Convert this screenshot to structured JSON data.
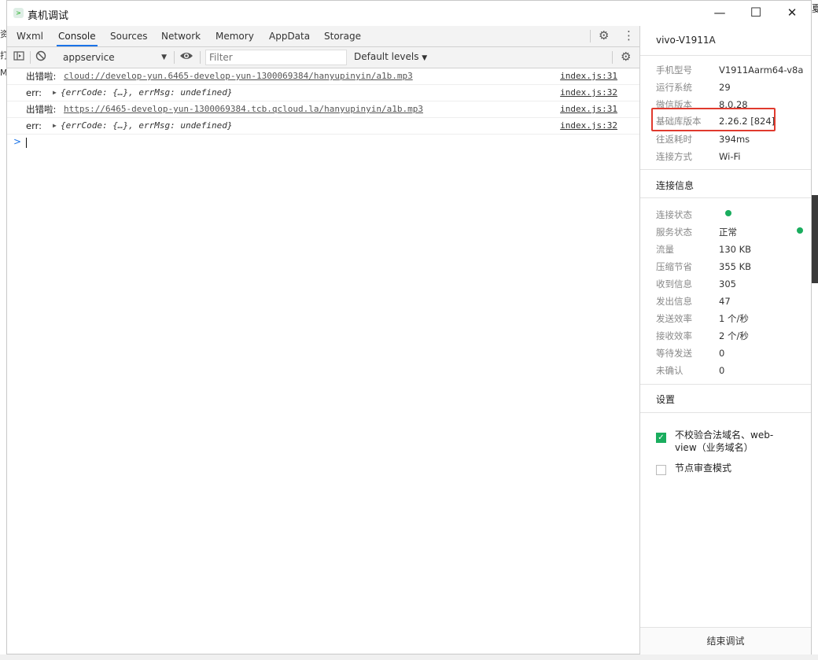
{
  "background": {
    "left_chars": [
      "资",
      "打",
      "M"
    ],
    "right_char": "夏"
  },
  "window": {
    "title": "真机调试",
    "icon": "wechat-devtools-icon",
    "controls": {
      "minimize": "—",
      "maximize": "☐",
      "close": "✕"
    }
  },
  "tabs": [
    {
      "label": "Wxml"
    },
    {
      "label": "Console",
      "active": true
    },
    {
      "label": "Sources"
    },
    {
      "label": "Network"
    },
    {
      "label": "Memory"
    },
    {
      "label": "AppData"
    },
    {
      "label": "Storage"
    }
  ],
  "toolbar": {
    "context": "appservice",
    "filter_placeholder": "Filter",
    "levels": "Default levels"
  },
  "console": {
    "rows": [
      {
        "label": "出错啦:",
        "text": "cloud://develop-yun.6465-develop-yun-1300069384/hanyupinyin/a1b.mp3",
        "source": "index.js:31"
      },
      {
        "label": "err:",
        "text": "{errCode: {…}, errMsg: undefined}",
        "source": "index.js:32"
      },
      {
        "label": "出错啦:",
        "text": "https://6465-develop-yun-1300069384.tcb.qcloud.la/hanyupinyin/a1b.mp3",
        "source": "index.js:31"
      },
      {
        "label": "err:",
        "text": "{errCode: {…}, errMsg: undefined}",
        "source": "index.js:32"
      }
    ],
    "prompt": ">"
  },
  "side": {
    "device": "vivo-V1911A",
    "info": {
      "model": {
        "k": "手机型号",
        "v": "V1911Aarm64-v8a"
      },
      "os": {
        "k": "运行系统",
        "v": "29"
      },
      "wechat": {
        "k": "微信版本",
        "v": "8.0.28"
      },
      "lib": {
        "k": "基础库版本",
        "v": "2.26.2 [824]"
      },
      "rtt": {
        "k": "往返耗时",
        "v": "394ms"
      },
      "conn": {
        "k": "连接方式",
        "v": "Wi-Fi"
      }
    },
    "conn_title": "连接信息",
    "conn": {
      "state": {
        "k": "连接状态",
        "v": ""
      },
      "service": {
        "k": "服务状态",
        "v": "正常"
      },
      "traffic": {
        "k": "流量",
        "v": "130 KB"
      },
      "saved": {
        "k": "压缩节省",
        "v": "355 KB"
      },
      "recv": {
        "k": "收到信息",
        "v": "305"
      },
      "sent": {
        "k": "发出信息",
        "v": "47"
      },
      "send_rate": {
        "k": "发送效率",
        "v": "1 个/秒"
      },
      "recv_rate": {
        "k": "接收效率",
        "v": "2 个/秒"
      },
      "pending": {
        "k": "等待发送",
        "v": "0"
      },
      "unack": {
        "k": "未确认",
        "v": "0"
      }
    },
    "settings_title": "设置",
    "settings": [
      {
        "label": "不校验合法域名、web-view（业务域名）",
        "checked": true
      },
      {
        "label": "节点审查模式",
        "checked": false
      }
    ],
    "end_button": "结束调试"
  },
  "colors": {
    "accent": "#1a73e8",
    "ok": "#1aad5e",
    "highlight": "#e03a2e"
  }
}
